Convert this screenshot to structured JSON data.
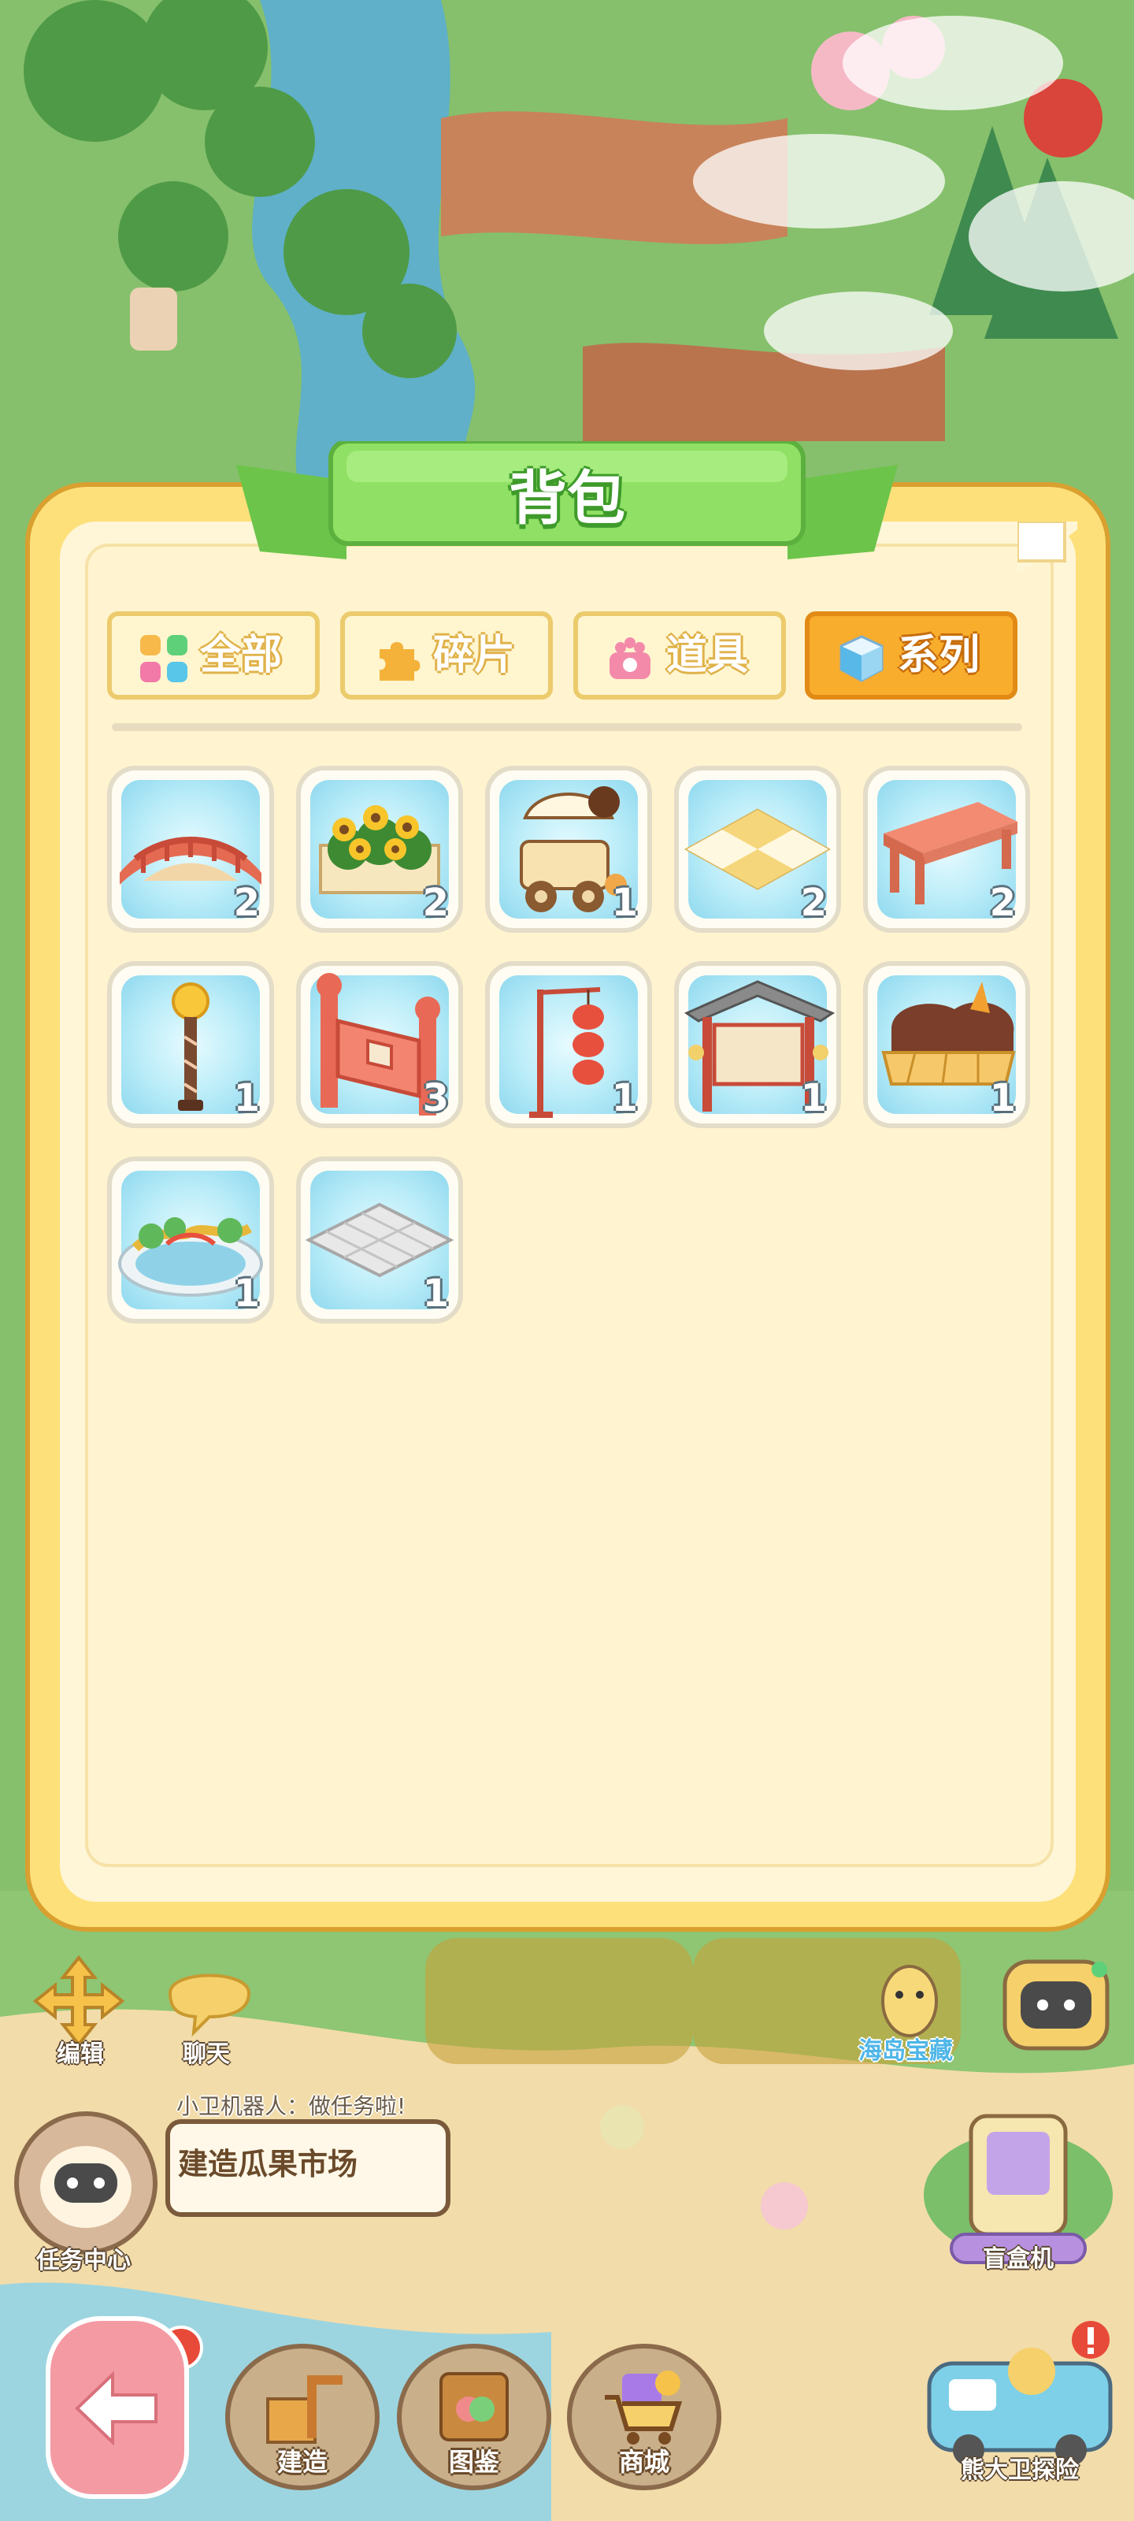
{
  "modal": {
    "title": "背包",
    "tabs": [
      {
        "label": "全部",
        "icon": "four-squares-icon",
        "active": false
      },
      {
        "label": "碎片",
        "icon": "puzzle-piece-icon",
        "active": false
      },
      {
        "label": "道具",
        "icon": "paw-box-icon",
        "active": false
      },
      {
        "label": "系列",
        "icon": "cube-icon",
        "active": true
      }
    ],
    "items": [
      {
        "icon": "red-bridge-icon",
        "count": "2"
      },
      {
        "icon": "sunflower-fence-icon",
        "count": "2"
      },
      {
        "icon": "ice-cream-cart-icon",
        "count": "1"
      },
      {
        "icon": "checkered-floor-tile-icon",
        "count": "2"
      },
      {
        "icon": "wooden-bench-icon",
        "count": "2"
      },
      {
        "icon": "golden-street-lamp-icon",
        "count": "1"
      },
      {
        "icon": "red-lattice-fence-icon",
        "count": "3"
      },
      {
        "icon": "red-lantern-pole-icon",
        "count": "1"
      },
      {
        "icon": "notice-board-gate-icon",
        "count": "1"
      },
      {
        "icon": "chocolate-bench-icon",
        "count": "1"
      },
      {
        "icon": "dragon-fountain-pond-icon",
        "count": "1"
      },
      {
        "icon": "stone-floor-tile-icon",
        "count": "1"
      }
    ]
  },
  "hud": {
    "edit_label": "编辑",
    "chat_label": "聊天",
    "island_treasure_label": "海岛宝藏",
    "robot_message": "小卫机器人：做任务啦!",
    "task_text": "建造瓜果市场",
    "task_center_label": "任务中心",
    "blind_box_label": "盲盒机",
    "adventure_label": "熊大卫探险",
    "nav": [
      {
        "label": "建造",
        "icon": "build-icon"
      },
      {
        "label": "图鉴",
        "icon": "book-icon"
      },
      {
        "label": "商城",
        "icon": "shop-cart-icon"
      }
    ],
    "back_icon": "back-arrow-icon"
  },
  "colors": {
    "panel": "#fff4cf",
    "panel_border": "#d9a030",
    "banner_green": "#7ed957",
    "tab_active": "#f9ad2c",
    "slot_bg": "#b9ecf8"
  }
}
